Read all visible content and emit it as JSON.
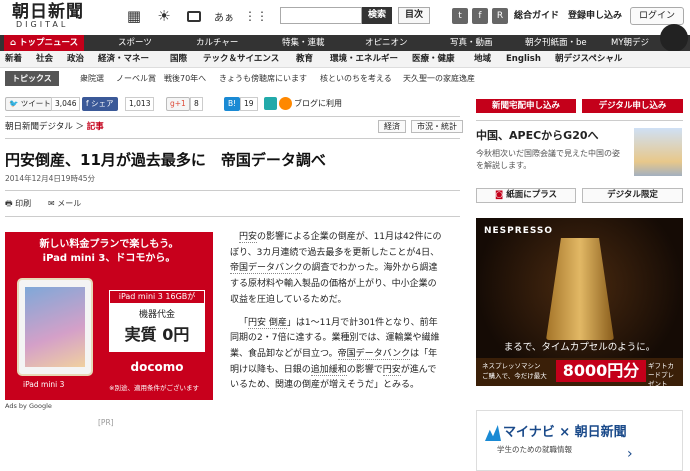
{
  "header": {
    "logo": "朝日新聞",
    "logo_sub": "DIGITAL",
    "icons": [
      {
        "name": "news-icon",
        "glyph": "▦"
      },
      {
        "name": "weather-icon",
        "glyph": "☀"
      },
      {
        "name": "tv-icon",
        "glyph": "📺"
      },
      {
        "name": "aa-icon",
        "glyph": "あぁ"
      },
      {
        "name": "grid-icon",
        "glyph": "⋮⋮"
      }
    ],
    "search_placeholder": "",
    "search_button": "検索",
    "toc_button": "目次",
    "social": [
      "t",
      "f",
      "R"
    ],
    "links": {
      "top": "総合ガイド",
      "signup": "登録申し込み"
    },
    "login": "ログイン"
  },
  "nav_main": [
    "トップニュース",
    "スポーツ",
    "カルチャー",
    "特集・連載",
    "オピニオン",
    "写真・動画",
    "朝夕刊紙面・be",
    "MY朝デジ"
  ],
  "nav_sub": [
    "新着",
    "社会",
    "政治",
    "経済・マネー",
    "国際",
    "テック＆サイエンス",
    "教育",
    "環境・エネルギー",
    "医療・健康",
    "地域",
    "English",
    "朝デジスペシャル"
  ],
  "topics": {
    "label": "トピックス",
    "items": [
      "衆院選",
      "ノーベル賞",
      "戦後70年へ",
      "きょうも傍聴席にいます",
      "核といのちを考える",
      "天久聖一の家庭逸産"
    ]
  },
  "share": {
    "tweet": "ツイート",
    "tweet_count": "3,046",
    "facebook": "シェア",
    "facebook_count": "1,013",
    "gplus": "g+1",
    "gplus_count": "8",
    "hatena": "B!",
    "hatena_count": "19",
    "blog": "ブログに利用"
  },
  "breadcrumb": {
    "site": "朝日新聞デジタル",
    "sep": "＞",
    "section": "記事"
  },
  "tags": [
    "経済",
    "市況・統計"
  ],
  "article": {
    "title": "円安倒産、11月が過去最多に　帝国データ調べ",
    "date": "2014年12月4日19時45分",
    "tools": {
      "print": "印刷",
      "mail": "メール"
    },
    "para1_a": "円安",
    "para1_b": "の影響による企業の倒産が、11月は42件にのぼり、3カ月連続で過去最多を更新したことが4日、",
    "para1_c": "帝国データバンク",
    "para1_d": "の調査でわかった。海外から調達する原材料や輸入製品の価格が上がり、中小企業の収益を圧迫しているためだ。",
    "para2_a": "「",
    "para2_b": "円安 倒産",
    "para2_c": "」は1～11月で計301件となり、前年同期の2・7倍に達する。業種別では、運輸業や繊維業、食品卸などが目立つ。",
    "para2_d": "帝国データバンク",
    "para2_e": "は「年明け以降も、日銀の",
    "para2_f": "追加緩和",
    "para2_g": "の影響で",
    "para2_h": "円安",
    "para2_i": "が進んでいるため、関連の倒産が増えそうだ」とみる。"
  },
  "ad": {
    "line1": "新しい料金プランで楽しもう。",
    "line2": "iPad mini 3、ドコモから。",
    "badge": "iPad mini 3 16GBが",
    "box_a": "機器代金",
    "box_b": "実質 0円",
    "brand": "docomo",
    "model": "iPad mini 3",
    "note": "※別途、適用条件がございます",
    "ads_by": "Ads by Google",
    "pr": "[PR]"
  },
  "right": {
    "btn_home": "新聞宅配申し込み",
    "btn_digital": "デジタル申し込み",
    "headline": "中国、APECからG20へ",
    "desc": "今秋相次いだ国際会議で見えた中国の姿を解説します。",
    "btn_paper": "紙面にプラス",
    "btn_limited": "デジタル限定",
    "nespresso": {
      "brand": "NESPRESSO",
      "tagline": "まるで、タイムカプセルのように。",
      "foot1": "ネスプレッソマシン",
      "foot2": "ご購入で、今だけ最大",
      "yen": "8000円分",
      "gift": "ギフトカードプレゼント"
    },
    "mynavi": {
      "brand": "マイナビ × 朝日新聞",
      "sub": "学生のための就職情報",
      "arrow": "›"
    }
  }
}
